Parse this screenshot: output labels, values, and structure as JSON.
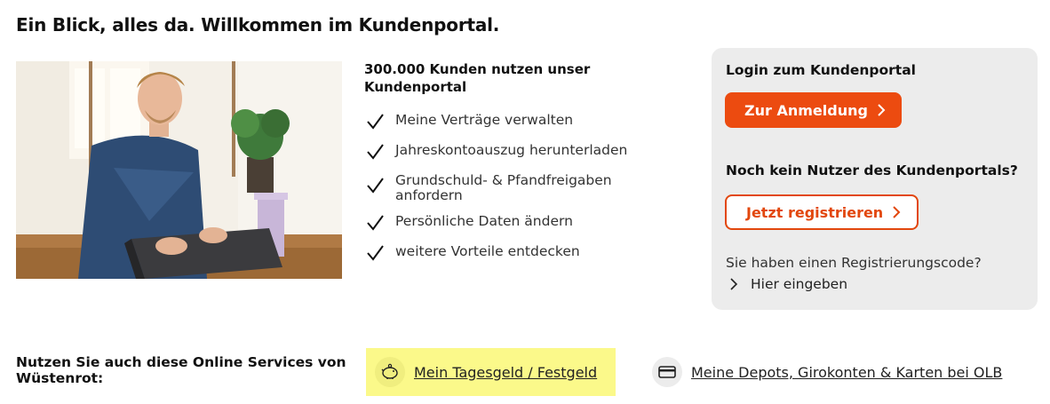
{
  "page": {
    "title": "Ein Blick, alles da. Willkommen im Kundenportal."
  },
  "features": {
    "title": "300.000 Kunden nutzen unser Kundenportal",
    "items": [
      "Meine Verträge verwalten",
      "Jahreskontoauszug herunterladen",
      "Grundschuld- & Pfandfreigaben anfordern",
      "Persönliche Daten ändern",
      "weitere Vorteile entdecken"
    ]
  },
  "login": {
    "heading": "Login zum Kundenportal",
    "button_label": "Zur Anmeldung",
    "register_heading": "Noch kein Nutzer des Kundenportals?",
    "register_button_label": "Jetzt registrieren",
    "code_question": "Sie haben einen Registrierungscode?",
    "code_link_label": "Hier eingeben"
  },
  "services": {
    "label": "Nutzen Sie auch diese Online Services von Wüstenrot:",
    "items": [
      {
        "label": "Mein Tagesgeld / Festgeld",
        "icon": "piggy-bank-icon"
      },
      {
        "label": "Meine Depots, Girokonten & Karten bei OLB",
        "icon": "credit-card-icon"
      }
    ]
  },
  "colors": {
    "accent": "#ec4b10",
    "panel_bg": "#ececec",
    "highlight": "#fbf98a"
  }
}
